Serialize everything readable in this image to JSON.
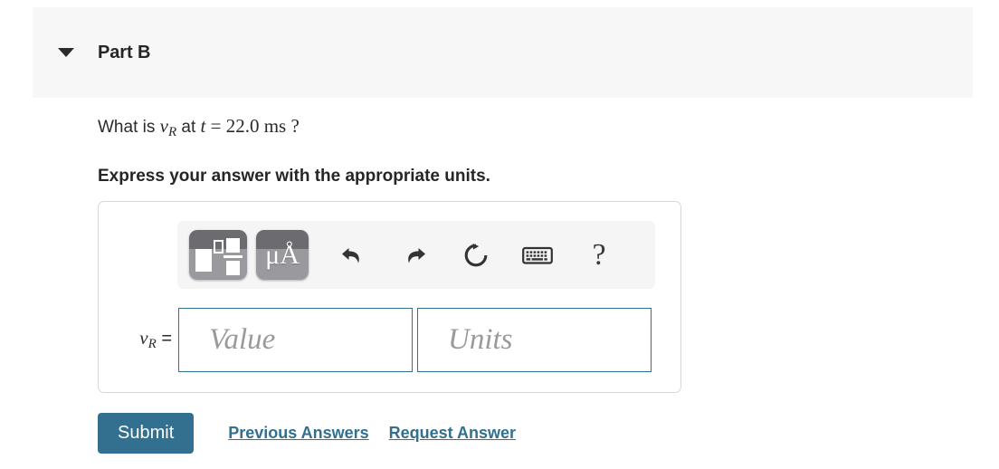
{
  "part": {
    "title": "Part B",
    "collapse_icon": "caret-down-icon"
  },
  "question": {
    "prefix": "What is ",
    "variable": "v",
    "variable_subscript": "R",
    "middle": " at ",
    "time_symbol": "t",
    "equals": "=",
    "time_value": "22.0 ms",
    "suffix": "?",
    "full_text": "What is vR at t = 22.0 ms ?"
  },
  "instruction": "Express your answer with the appropriate units.",
  "toolbar": {
    "template_button": {
      "name": "math-template-button",
      "tooltip": "Templates"
    },
    "units_button": {
      "name": "units-button",
      "glyph": "μÅ"
    },
    "undo_button": {
      "name": "undo-icon"
    },
    "redo_button": {
      "name": "redo-icon"
    },
    "reset_button": {
      "name": "reset-icon"
    },
    "keyboard_button": {
      "name": "keyboard-icon"
    },
    "help_button": {
      "name": "help-icon",
      "glyph": "?"
    }
  },
  "answer": {
    "label_variable": "v",
    "label_subscript": "R",
    "label_equals": "=",
    "value_placeholder": "Value",
    "value": "",
    "units_placeholder": "Units",
    "units": ""
  },
  "actions": {
    "submit_label": "Submit",
    "previous_answers_label": "Previous Answers",
    "request_answer_label": "Request Answer"
  },
  "colors": {
    "accent": "#31708f",
    "submit_bg": "#33708f",
    "header_band": "#f7f7f7",
    "panel_border": "#d8d8d8",
    "toolbar_bg": "#f5f5f5",
    "placeholder_text": "#9a9a9a"
  }
}
